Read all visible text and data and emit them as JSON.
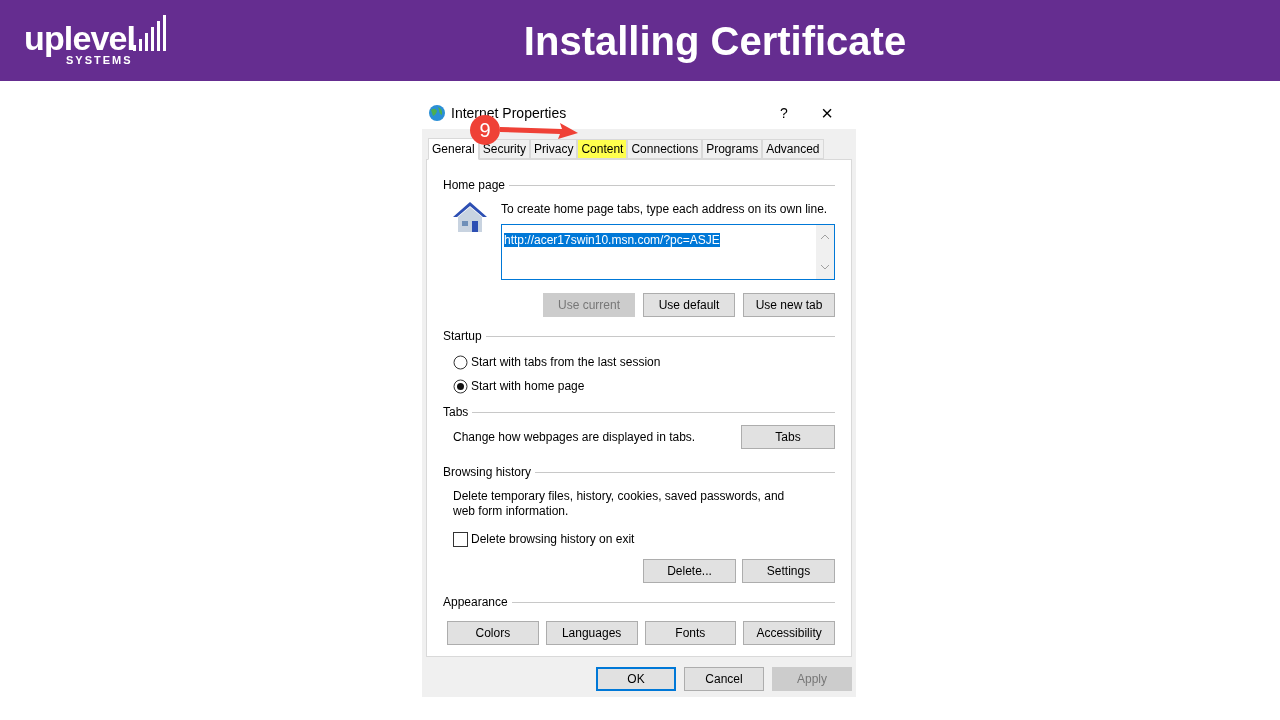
{
  "header": {
    "logo_word": "uplevel",
    "logo_sub": "SYSTEMS",
    "title": "Installing Certificate"
  },
  "dialog": {
    "title": "Internet Properties",
    "help": "?",
    "close": "×",
    "step_badge": "9",
    "tabs": [
      {
        "label": "General",
        "selected": true,
        "highlighted": false
      },
      {
        "label": "Security",
        "selected": false,
        "highlighted": false
      },
      {
        "label": "Privacy",
        "selected": false,
        "highlighted": false
      },
      {
        "label": "Content",
        "selected": false,
        "highlighted": true
      },
      {
        "label": "Connections",
        "selected": false,
        "highlighted": false
      },
      {
        "label": "Programs",
        "selected": false,
        "highlighted": false
      },
      {
        "label": "Advanced",
        "selected": false,
        "highlighted": false
      }
    ],
    "home_page": {
      "heading": "Home page",
      "instruction": "To create home page tabs, type each address on its own line.",
      "url": "http://acer17swin10.msn.com/?pc=ASJE",
      "buttons": [
        {
          "label": "Use current",
          "disabled": true
        },
        {
          "label": "Use default",
          "disabled": false
        },
        {
          "label": "Use new tab",
          "disabled": false
        }
      ]
    },
    "startup": {
      "heading": "Startup",
      "options": [
        {
          "label": "Start with tabs from the last session",
          "selected": false
        },
        {
          "label": "Start with home page",
          "selected": true
        }
      ]
    },
    "tabs_section": {
      "heading": "Tabs",
      "text": "Change how webpages are displayed in tabs.",
      "button": "Tabs"
    },
    "browsing_history": {
      "heading": "Browsing history",
      "text": "Delete temporary files, history, cookies, saved passwords, and web form information.",
      "checkbox": {
        "label": "Delete browsing history on exit",
        "checked": false
      },
      "buttons": [
        {
          "label": "Delete...",
          "disabled": false
        },
        {
          "label": "Settings",
          "disabled": false
        }
      ]
    },
    "appearance": {
      "heading": "Appearance",
      "buttons": [
        {
          "label": "Colors",
          "disabled": false
        },
        {
          "label": "Languages",
          "disabled": false
        },
        {
          "label": "Fonts",
          "disabled": false
        },
        {
          "label": "Accessibility",
          "disabled": false
        }
      ]
    },
    "footer_buttons": [
      {
        "label": "OK",
        "disabled": false,
        "default": true
      },
      {
        "label": "Cancel",
        "disabled": false,
        "default": false
      },
      {
        "label": "Apply",
        "disabled": true,
        "default": false
      }
    ]
  }
}
